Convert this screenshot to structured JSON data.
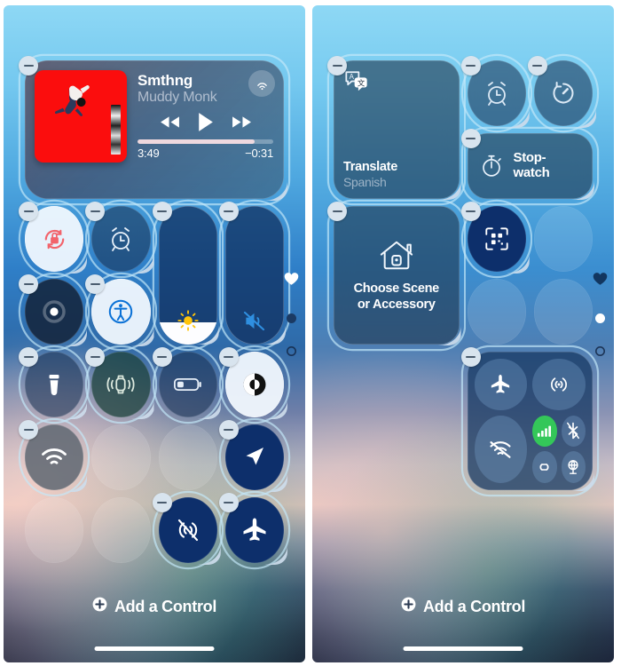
{
  "panels": [
    {
      "id": "left",
      "media": {
        "track": "Smthng",
        "artist": "Muddy Monk",
        "elapsed": "3:49",
        "remaining": "−0:31",
        "progress_percent": 86,
        "airplay_icon": "airplay-icon",
        "rewind_icon": "rewind-icon",
        "play_icon": "play-icon",
        "forward_icon": "fast-forward-icon",
        "artwork_color": "#fb0d0d"
      },
      "controls": [
        {
          "name": "rotation-lock",
          "icon": "rotation-lock-icon",
          "style": "light",
          "shape": "circle"
        },
        {
          "name": "alarm",
          "icon": "alarm-clock-icon",
          "style": "glass",
          "shape": "circle"
        },
        {
          "name": "brightness",
          "icon": "brightness-icon",
          "style": "slider",
          "shape": "slider",
          "fill_percent": 16
        },
        {
          "name": "silent-mode",
          "icon": "speaker-mute-icon",
          "style": "slider",
          "shape": "slider",
          "fill_percent": 0
        },
        {
          "name": "screen-mirroring",
          "icon": "screen-mirroring-icon",
          "style": "dark",
          "shape": "circle"
        },
        {
          "name": "accessibility",
          "icon": "accessibility-icon",
          "style": "light",
          "shape": "circle"
        },
        {
          "name": "flashlight",
          "icon": "flashlight-icon",
          "style": "glass",
          "shape": "circle"
        },
        {
          "name": "ping-watch",
          "icon": "ping-watch-icon",
          "style": "green",
          "shape": "circle"
        },
        {
          "name": "low-power-mode",
          "icon": "battery-icon",
          "style": "glass",
          "shape": "circle"
        },
        {
          "name": "dark-mode",
          "icon": "dark-mode-icon",
          "style": "light",
          "shape": "circle"
        },
        {
          "name": "wifi-toggle",
          "icon": "wifi-icon",
          "style": "grey",
          "shape": "circle"
        },
        {
          "name": "empty-slot",
          "icon": "",
          "style": "empty",
          "shape": "circle"
        },
        {
          "name": "empty-slot",
          "icon": "",
          "style": "empty",
          "shape": "circle"
        },
        {
          "name": "pointer-control",
          "icon": "cursor-arrow-icon",
          "style": "deep",
          "shape": "circle"
        },
        {
          "name": "empty-slot",
          "icon": "",
          "style": "empty",
          "shape": "circle"
        },
        {
          "name": "empty-slot",
          "icon": "",
          "style": "empty",
          "shape": "circle"
        },
        {
          "name": "airdrop-off",
          "icon": "airdrop-off-icon",
          "style": "deep",
          "shape": "circle"
        },
        {
          "name": "airplane-mode",
          "icon": "airplane-icon",
          "style": "deep",
          "shape": "circle"
        }
      ],
      "page_indicators": [
        {
          "name": "favorites-page",
          "icon": "heart-icon",
          "state": "white"
        },
        {
          "name": "page-dot-1",
          "icon": "dot-icon",
          "state": "filled-dark"
        },
        {
          "name": "page-dot-2",
          "icon": "dot-icon",
          "state": "hollow"
        }
      ],
      "footer": {
        "label": "Add a Control",
        "icon": "plus-circle-icon"
      }
    },
    {
      "id": "right",
      "widgets": {
        "translate": {
          "title": "Translate",
          "subtitle": "Spanish",
          "icon": "translate-icon"
        },
        "stopwatch": {
          "title": "Stop-\nwatch",
          "title_line1": "Stop-",
          "title_line2": "watch",
          "icon": "stopwatch-icon"
        },
        "home": {
          "title_line1": "Choose Scene",
          "title_line2": "or Accessory",
          "icon": "home-icon"
        }
      },
      "controls": [
        {
          "name": "alarm",
          "icon": "alarm-clock-icon",
          "style": "glass",
          "shape": "circle"
        },
        {
          "name": "timer",
          "icon": "timer-icon",
          "style": "glass",
          "shape": "circle"
        },
        {
          "name": "code-scanner",
          "icon": "qr-code-icon",
          "style": "deep",
          "shape": "circle"
        },
        {
          "name": "empty-slot",
          "icon": "",
          "style": "empty",
          "shape": "circle"
        }
      ],
      "connectivity": {
        "name": "connectivity-module",
        "buttons": [
          {
            "name": "airplane-mode-toggle",
            "icon": "airplane-icon",
            "active": false
          },
          {
            "name": "airdrop-toggle",
            "icon": "airdrop-icon",
            "active": false
          },
          {
            "name": "wifi-toggle",
            "icon": "wifi-off-icon",
            "active": false
          },
          {
            "name": "cellular-data-toggle",
            "icon": "cellular-bars-icon",
            "active": true
          },
          {
            "name": "bluetooth-toggle",
            "icon": "bluetooth-off-icon",
            "active": false
          },
          {
            "name": "personal-hotspot-toggle",
            "icon": "hotspot-icon",
            "active": false
          },
          {
            "name": "vpn-toggle",
            "icon": "vpn-icon",
            "active": false
          }
        ],
        "active_color": "#34c759"
      },
      "page_indicators": [
        {
          "name": "favorites-page",
          "icon": "heart-icon",
          "state": "dark"
        },
        {
          "name": "page-dot-1",
          "icon": "dot-icon",
          "state": "filled-white"
        },
        {
          "name": "page-dot-2",
          "icon": "dot-icon",
          "state": "hollow"
        }
      ],
      "footer": {
        "label": "Add a Control",
        "icon": "plus-circle-icon"
      }
    }
  ]
}
